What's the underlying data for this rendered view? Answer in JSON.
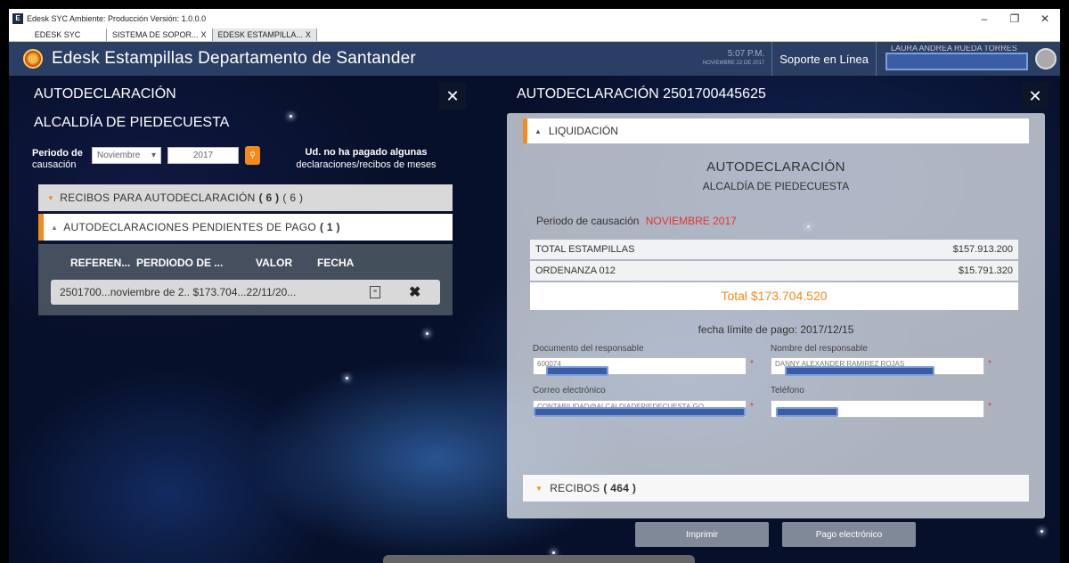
{
  "window": {
    "title": "Edesk SYC Ambiente: Producción  Versión: 1.0.0.0",
    "icon_label": "E",
    "controls": {
      "minimize": "–",
      "maximize": "❐",
      "close": "✕"
    }
  },
  "tabs": [
    {
      "label": "EDESK SYC",
      "close": ""
    },
    {
      "label": "SISTEMA DE SOPOR...",
      "close": "X"
    },
    {
      "label": "EDESK ESTAMPILLA...",
      "close": "X"
    }
  ],
  "header": {
    "title": "Edesk Estampillas Departamento de Santander",
    "time": "5:07 P.M.",
    "date": "NOVIEMBRE 22 DE 2017",
    "support_label": "Soporte en Línea",
    "user_name": "LAURA ANDREA RUEDA TORRES"
  },
  "left_panel": {
    "title": "AUTODECLARACIÓN",
    "close": "✕",
    "subtitle": "ALCALDÍA DE PIEDECUESTA",
    "period_label_1": "Periodo de",
    "period_label_2": "causación",
    "month_value": "Noviembre",
    "month_caret": "▾",
    "year_value": "2017",
    "search_icon": "⚲",
    "notice_1": "Ud. no ha pagado algunas",
    "notice_2": "declaraciones/recibos de meses",
    "acc_receipts": {
      "label": "RECIBOS PARA AUTODECLARACIÓN",
      "count": "( 6 )",
      "count2": "( 6 )",
      "icon": "▼"
    },
    "acc_pending": {
      "label": "AUTODECLARACIONES PENDIENTES DE PAGO",
      "count": "( 1 )",
      "icon": "▲"
    },
    "table": {
      "headers": [
        "REFEREN...",
        "PERDIODO DE ...",
        "VALOR",
        "FECHA"
      ],
      "rows": [
        {
          "text": "2501700...noviembre de 2.. $173.704...22/11/20...",
          "doc_icon": "≡",
          "delete_icon": "✖"
        }
      ]
    }
  },
  "right_panel": {
    "title": "AUTODECLARACIÓN 2501700445625",
    "close": "✕",
    "liquidacion": {
      "label": "LIQUIDACIÓN",
      "icon": "▲"
    },
    "doc_title": "AUTODECLARACIÓN",
    "doc_subtitle": "ALCALDÍA DE PIEDECUESTA",
    "period_label": "Periodo de causación",
    "period_value": "NOVIEMBRE 2017",
    "amounts": [
      {
        "label": "TOTAL ESTAMPILLAS",
        "value": "$157.913.200"
      },
      {
        "label": "ORDENANZA 012",
        "value": "$15.791.320"
      }
    ],
    "total": "Total $173.704.520",
    "due_date": "fecha límite de pago: 2017/12/15",
    "fields": {
      "doc_label": "Documento del responsable",
      "doc_value": "600074",
      "name_label": "Nombre del responsable",
      "name_value": "DANNY ALEXANDER RAMIREZ ROJAS",
      "email_label": "Correo electrónico",
      "email_value": "CONTABILIDAD@ALCALDIADEPIEDECUESTA.GO",
      "phone_label": "Teléfono",
      "phone_value": "",
      "required": "*"
    },
    "recibos": {
      "label": "RECIBOS",
      "count": "( 464 )",
      "icon": "▼"
    },
    "print_button": "Imprimir",
    "pay_button": "Pago electrónico"
  },
  "colors": {
    "accent": "#f28a1c",
    "header": "#2b3e63",
    "alert": "#e8332a"
  }
}
